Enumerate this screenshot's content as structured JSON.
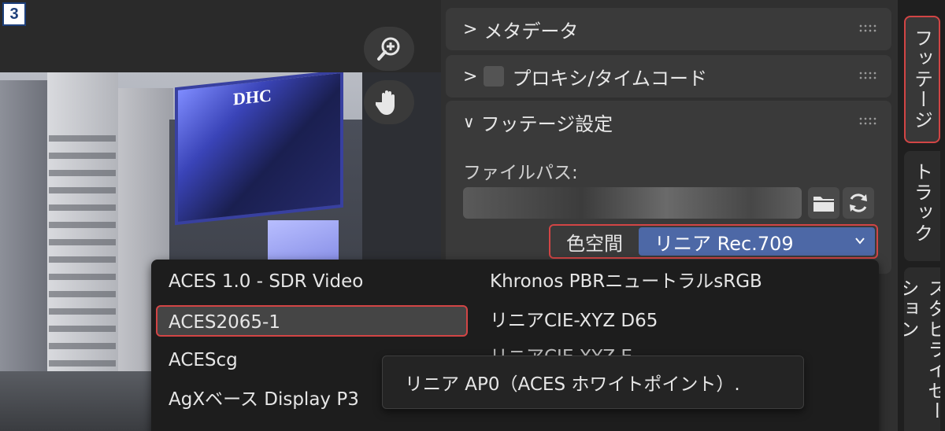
{
  "step_badge": "3",
  "viewport": {
    "zoom_icon": "zoom-in-icon",
    "pan_icon": "hand-icon",
    "billboard_text": "DHC"
  },
  "panel": {
    "sections": {
      "metadata": {
        "label": "メタデータ"
      },
      "proxy": {
        "label": "プロキシ/タイムコード"
      },
      "footage": {
        "label": "フッテージ設定",
        "file_path_label": "ファイルパス:",
        "color_space_label": "色空間",
        "color_space_value": "リニア Rec.709"
      }
    }
  },
  "dropdown": {
    "left_options": [
      "ACES 1.0 - SDR Video",
      "ACES2065-1",
      "ACEScg",
      "AgXベース Display P3"
    ],
    "right_options": [
      "Khronos PBRニュートラルsRGB",
      "リニアCIE-XYZ D65",
      "リニアCIE-XYZ E"
    ],
    "selected": "ACES2065-1",
    "tooltip": "リニア AP0（ACES ホワイトポイント）."
  },
  "tabs": [
    "フッテージ",
    "トラック",
    "スタビライゼーション"
  ],
  "colors": {
    "accent_red": "#d24545",
    "select_blue": "#4d68a6"
  }
}
